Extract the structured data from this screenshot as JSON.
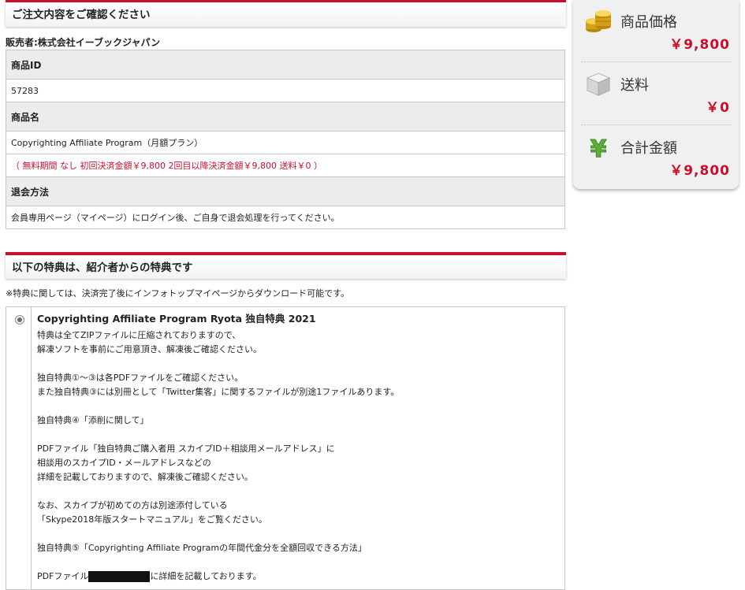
{
  "order": {
    "header": "ご注文内容をご確認ください",
    "seller": "販売者:株式会社イーブックジャパン",
    "rows": {
      "product_id_label": "商品ID",
      "product_id_value": "57283",
      "product_name_label": "商品名",
      "product_name_value": "Copyrighting Affiliate Program（月額プラン）",
      "payment_note": "（ 無料期間 なし  初回決済金額￥9,800  2回目以降決済金額￥9,800  送料￥0 ）",
      "withdraw_label": "退会方法",
      "withdraw_value": "会員専用ページ（マイページ）にログイン後、ご自身で退会処理を行ってください。"
    }
  },
  "benefits": {
    "header": "以下の特典は、紹介者からの特典です",
    "notice": "※特典に関しては、決済完了後にインフォトップマイページからダウンロード可能です。",
    "selected": true,
    "title": "Copyrighting Affiliate Program Ryota 独自特典 2021",
    "lines": [
      "特典は全てZIPファイルに圧縮されておりますので、",
      "解凍ソフトを事前にご用意頂き、解凍後ご確認ください。",
      "",
      "独自特典①～③は各PDFファイルをご確認ください。",
      "また独自特典③には別冊として「Twitter集客」に関するファイルが別途1ファイルあります。",
      "",
      "独自特典④「添削に関して」",
      "",
      "PDFファイル「独自特典ご購入者用 スカイプID＋相談用メールアドレス」に",
      "相談用のスカイプID・メールアドレスなどの",
      "詳細を記載しておりますので、解凍後ご確認ください。",
      "",
      "なお、スカイプが初めての方は別途添付している",
      "「Skype2018年版スタートマニュアル」をご覧ください。",
      "",
      "独自特典⑤「Copyrighting Affiliate Programの年間代金分を全額回収できる方法」",
      ""
    ],
    "last_line_prefix": "PDFファイル",
    "last_line_suffix": "に詳細を記載しております。"
  },
  "summary": {
    "price_label": "商品価格",
    "price_value": "￥9,800",
    "shipping_label": "送料",
    "shipping_value": "￥0",
    "total_label": "合計金額",
    "total_value": "￥9,800",
    "accent_color": "#c8102e"
  }
}
